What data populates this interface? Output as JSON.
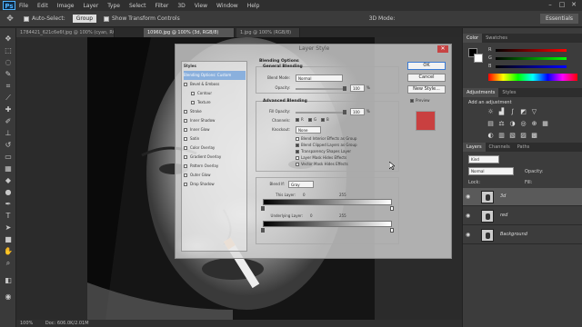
{
  "menubar": {
    "logo": "Ps",
    "items": [
      "File",
      "Edit",
      "Image",
      "Layer",
      "Type",
      "Select",
      "Filter",
      "3D",
      "View",
      "Window",
      "Help"
    ],
    "window_controls": [
      "–",
      "□",
      "✕"
    ]
  },
  "options": {
    "auto_select_label": "Auto-Select:",
    "auto_select_value": "Group",
    "transform_label": "Show Transform Controls",
    "mode_label": "3D Mode:",
    "workspace": "Essentials"
  },
  "tabs": [
    "1784421_621c6e6f.jpg @ 100% (cyan, RGB/8)",
    "10960.jpg @ 100% (3d, RGB/8)",
    "1.jpg @ 100% (RGB/8)"
  ],
  "status": {
    "zoom": "100%",
    "doc": "Doc: 606.0K/2.01M"
  },
  "color_panel": {
    "tabs": [
      "Color",
      "Swatches"
    ],
    "channels": [
      "R",
      "G",
      "B"
    ]
  },
  "adjustments_panel": {
    "tabs": [
      "Adjustments",
      "Styles"
    ],
    "title": "Add an adjustment"
  },
  "layers_panel": {
    "tabs": [
      "Layers",
      "Channels",
      "Paths"
    ],
    "kind_label": "Kind",
    "blend_mode": "Normal",
    "opacity_label": "Opacity:",
    "lock_label": "Lock:",
    "fill_label": "Fill:",
    "layers": [
      {
        "name": "3d",
        "active": true
      },
      {
        "name": "red",
        "active": false
      },
      {
        "name": "Background",
        "active": false
      }
    ]
  },
  "dialog": {
    "title": "Layer Style",
    "close": "✕",
    "styles_header": "Styles",
    "styles": [
      {
        "label": "Blending Options: Custom",
        "checkbox": false,
        "selected": true,
        "indent": false
      },
      {
        "label": "Bevel & Emboss",
        "checkbox": true,
        "selected": false,
        "indent": false
      },
      {
        "label": "Contour",
        "checkbox": true,
        "selected": false,
        "indent": true
      },
      {
        "label": "Texture",
        "checkbox": true,
        "selected": false,
        "indent": true
      },
      {
        "label": "Stroke",
        "checkbox": true,
        "selected": false,
        "indent": false
      },
      {
        "label": "Inner Shadow",
        "checkbox": true,
        "selected": false,
        "indent": false
      },
      {
        "label": "Inner Glow",
        "checkbox": true,
        "selected": false,
        "indent": false
      },
      {
        "label": "Satin",
        "checkbox": true,
        "selected": false,
        "indent": false
      },
      {
        "label": "Color Overlay",
        "checkbox": true,
        "selected": false,
        "indent": false
      },
      {
        "label": "Gradient Overlay",
        "checkbox": true,
        "selected": false,
        "indent": false
      },
      {
        "label": "Pattern Overlay",
        "checkbox": true,
        "selected": false,
        "indent": false
      },
      {
        "label": "Outer Glow",
        "checkbox": true,
        "selected": false,
        "indent": false
      },
      {
        "label": "Drop Shadow",
        "checkbox": true,
        "selected": false,
        "indent": false
      }
    ],
    "blending_options": "Blending Options",
    "general_blending": "General Blending",
    "blend_mode_label": "Blend Mode:",
    "blend_mode_value": "Normal",
    "opacity_label": "Opacity:",
    "opacity_value": "100",
    "advanced_blending": "Advanced Blending",
    "fill_opacity_label": "Fill Opacity:",
    "fill_opacity_value": "100",
    "channels_label": "Channels:",
    "channels": [
      "R",
      "G",
      "B"
    ],
    "knockout_label": "Knockout:",
    "knockout_value": "None",
    "checks": [
      {
        "label": "Blend Interior Effects as Group",
        "on": false
      },
      {
        "label": "Blend Clipped Layers as Group",
        "on": true
      },
      {
        "label": "Transparency Shapes Layer",
        "on": true
      },
      {
        "label": "Layer Mask Hides Effects",
        "on": false
      },
      {
        "label": "Vector Mask Hides Effects",
        "on": false
      }
    ],
    "blend_if_label": "Blend If:",
    "blend_if_value": "Gray",
    "this_layer_label": "This Layer:",
    "this_layer_min": "0",
    "this_layer_max": "255",
    "underlying_label": "Underlying Layer:",
    "underlying_min": "0",
    "underlying_max": "255",
    "buttons": {
      "ok": "OK",
      "cancel": "Cancel",
      "new_style": "New Style...",
      "preview": "Preview"
    },
    "preview_color": "#c94040"
  }
}
